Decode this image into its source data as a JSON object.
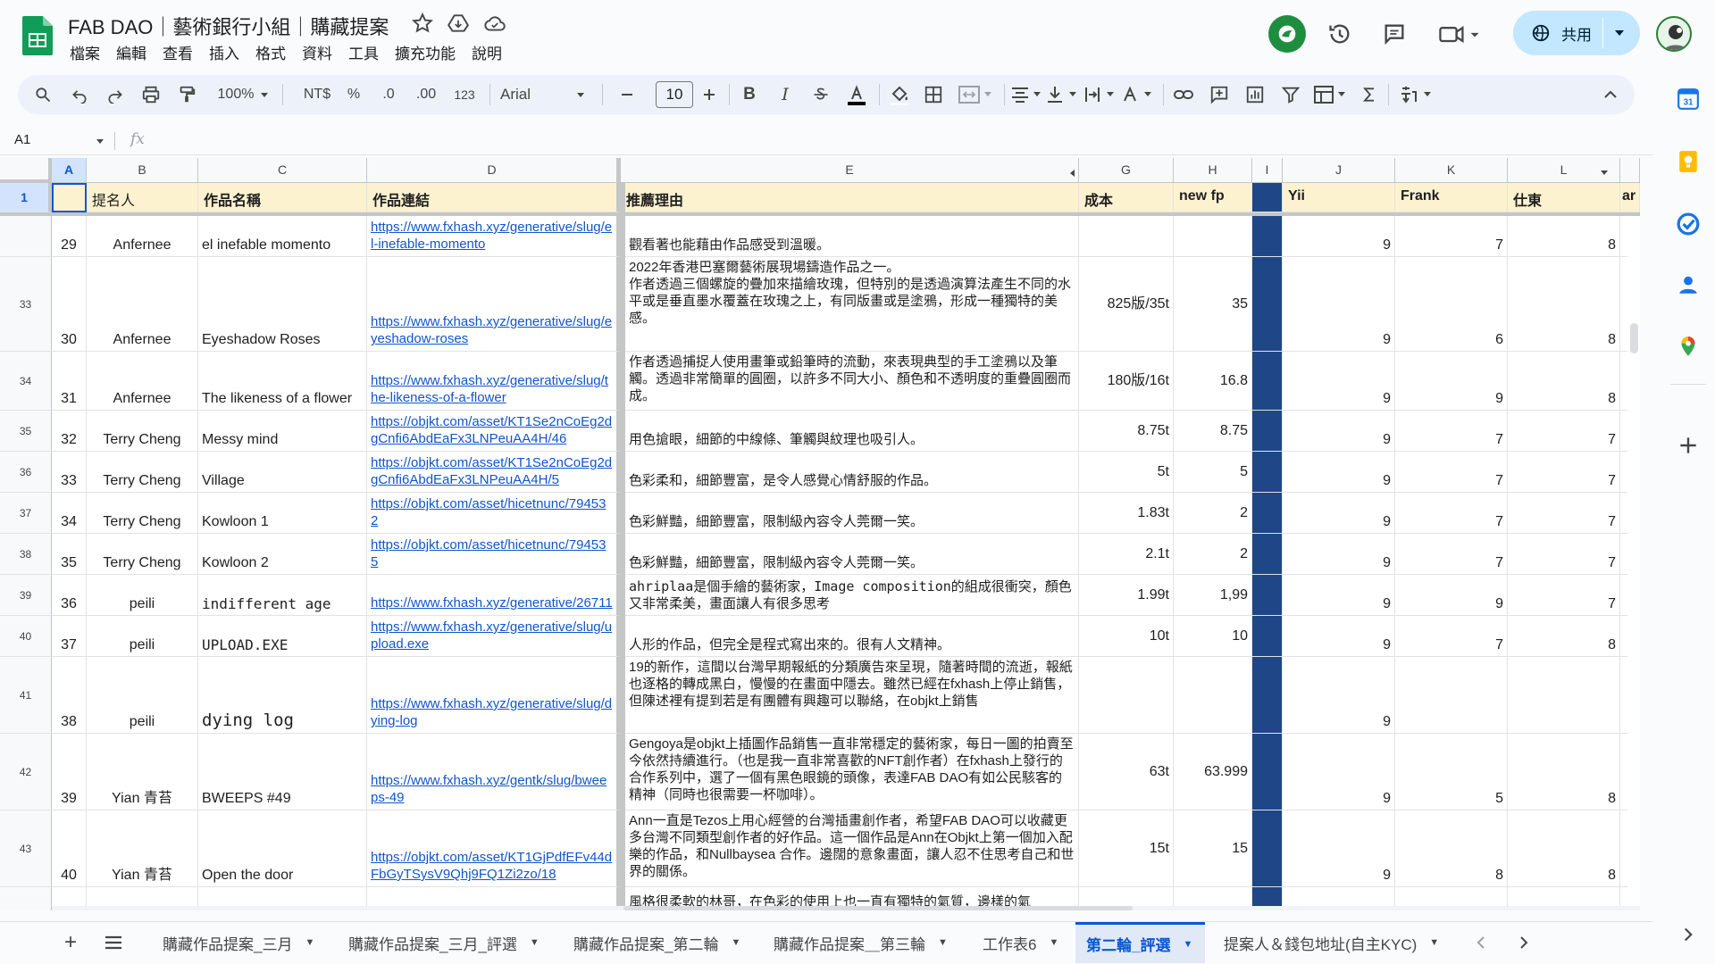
{
  "doc": {
    "title": "FAB DAO｜藝術銀行小組｜購藏提案"
  },
  "menu": [
    "檔案",
    "編輯",
    "查看",
    "插入",
    "格式",
    "資料",
    "工具",
    "擴充功能",
    "說明"
  ],
  "share": {
    "label": "共用"
  },
  "toolbar": {
    "zoom": "100%",
    "currency": "NT$",
    "percent": "%",
    "dec_minus": ".0",
    "dec_plus": ".00",
    "format123": "123",
    "font": "Arial",
    "font_size": "10"
  },
  "formula": {
    "cell_ref": "A1",
    "fx": "fx"
  },
  "columns": [
    "A",
    "B",
    "C",
    "D",
    "E",
    "G",
    "H",
    "I",
    "J",
    "K",
    "L"
  ],
  "header_row": {
    "row_num": "1",
    "B": "提名人",
    "C": "作品名稱",
    "D": "作品連結",
    "E": "推薦理由",
    "G": "成本",
    "H": "new fp",
    "J": "Yii",
    "K": "Frank",
    "L": "仕東",
    "M": "ar"
  },
  "rows": [
    {
      "rownum": "",
      "a": "29",
      "b": "Anfernee",
      "c": "el inefable momento",
      "d": "https://www.fxhash.xyz/generative/slug/el-inefable-momento",
      "e": "觀看著也能藉由作品感受到溫暖。",
      "g": "",
      "h": "",
      "j": "9",
      "k": "7",
      "l": "8"
    },
    {
      "rownum": "33",
      "a": "30",
      "b": "Anfernee",
      "c": "Eyeshadow Roses",
      "d": "https://www.fxhash.xyz/generative/slug/eyeshadow-roses",
      "e": "2022年香港巴塞爾藝術展現場鑄造作品之一。\n作者透過三個螺旋的疊加來描繪玫瑰，但特別的是透過演算法產生不同的水平或是垂直墨水覆蓋在玫瑰之上，有同版畫或是塗鴉，形成一種獨特的美感。",
      "g": "825版/35t",
      "h": "35",
      "j": "9",
      "k": "6",
      "l": "8"
    },
    {
      "rownum": "34",
      "a": "31",
      "b": "Anfernee",
      "c": "The likeness of a flower",
      "d": "https://www.fxhash.xyz/generative/slug/the-likeness-of-a-flower",
      "e": "作者透過捕捉人使用畫筆或鉛筆時的流動，來表現典型的手工塗鴉以及筆觸。透過非常簡單的圓圈，以許多不同大小、顏色和不透明度的重疊圓圈而成。",
      "g": "180版/16t",
      "h": "16.8",
      "j": "9",
      "k": "9",
      "l": "8"
    },
    {
      "rownum": "35",
      "a": "32",
      "b": "Terry Cheng",
      "c": "Messy mind",
      "d": "https://objkt.com/asset/KT1Se2nCoEg2dgCnfi6AbdEaFx3LNPeuAA4H/46",
      "e": "用色搶眼，細節的中線條、筆觸與紋理也吸引人。",
      "g": "8.75t",
      "h": "8.75",
      "j": "9",
      "k": "7",
      "l": "7"
    },
    {
      "rownum": "36",
      "a": "33",
      "b": "Terry Cheng",
      "c": "Village",
      "d": "https://objkt.com/asset/KT1Se2nCoEg2dgCnfi6AbdEaFx3LNPeuAA4H/5",
      "e": "色彩柔和，細節豐富，是令人感覺心情舒服的作品。",
      "g": "5t",
      "h": "5",
      "j": "9",
      "k": "7",
      "l": "7"
    },
    {
      "rownum": "37",
      "a": "34",
      "b": "Terry Cheng",
      "c": "Kowloon 1",
      "d": "https://objkt.com/asset/hicetnunc/794532",
      "e": "色彩鮮豔，細節豐富，限制級內容令人莞爾一笑。",
      "g": "1.83t",
      "h": "2",
      "j": "9",
      "k": "7",
      "l": "7"
    },
    {
      "rownum": "38",
      "a": "35",
      "b": "Terry Cheng",
      "c": "Kowloon 2",
      "d": "https://objkt.com/asset/hicetnunc/794535",
      "e": "色彩鮮豔，細節豐富，限制級內容令人莞爾一笑。",
      "g": "2.1t",
      "h": "2",
      "j": "9",
      "k": "7",
      "l": "7"
    },
    {
      "rownum": "39",
      "a": "36",
      "b": "peili",
      "c": "indifferent age",
      "d": "https://www.fxhash.xyz/generative/26711",
      "e": "ahriplaa是個手繪的藝術家，Image composition的組成很衝突，顏色又非常柔美，畫面讓人有很多思考",
      "g": "1.99t",
      "h": "1,99",
      "j": "9",
      "k": "9",
      "l": "7"
    },
    {
      "rownum": "40",
      "a": "37",
      "b": "peili",
      "c": "UPLOAD.EXE",
      "d": "https://www.fxhash.xyz/generative/slug/upload.exe",
      "e": "人形的作品，但完全是程式寫出來的。很有人文精神。",
      "g": "10t",
      "h": "10",
      "j": "9",
      "k": "7",
      "l": "8"
    },
    {
      "rownum": "41",
      "a": "38",
      "b": "peili",
      "c": "dying log",
      "d": "https://www.fxhash.xyz/generative/slug/dying-log",
      "e": "19的新作，這間以台灣早期報紙的分類廣告來呈現，隨著時間的流逝，報紙也逐格的轉成黑白，慢慢的在畫面中隱去。雖然已經在fxhash上停止銷售，但陳述裡有提到若是有團體有興趣可以聯絡，在objkt上銷售",
      "g": "",
      "h": "",
      "j": "9",
      "k": "",
      "l": ""
    },
    {
      "rownum": "42",
      "a": "39",
      "b": "Yian 青苔",
      "c": "BWEEPS #49",
      "d": "https://www.fxhash.xyz/gentk/slug/bweeps-49",
      "e": "Gengoya是objkt上插圖作品銷售一直非常穩定的藝術家，每日一圖的拍賣至今依然持續進行。（也是我一直非常喜歡的NFT創作者）在fxhash上發行的合作系列中，選了一個有黑色眼鏡的頭像，表達FAB DAO有如公民駭客的精神（同時也很需要一杯咖啡）。",
      "g": "63t",
      "h": "63.999",
      "j": "9",
      "k": "5",
      "l": "8"
    },
    {
      "rownum": "43",
      "a": "40",
      "b": "Yian 青苔",
      "c": "Open the door",
      "d": "https://objkt.com/asset/KT1GjPdfEFv44dFbGyTSysV9Qhj9FQ1Zi2zo/18",
      "e": "Ann一直是Tezos上用心經營的台灣插畫創作者，希望FAB DAO可以收藏更多台灣不同類型創作者的好作品。這一個作品是Ann在Objkt上第一個加入配樂的作品，和Nullbaysea 合作。邊闊的意象畫面，讓人忍不住思考自己和世界的關係。",
      "g": "15t",
      "h": "15",
      "j": "9",
      "k": "8",
      "l": "8"
    },
    {
      "rownum": "",
      "a": "",
      "b": "",
      "c": "",
      "d": "",
      "e": "風格很柔軟的林哥，在色彩的使用上也一直有獨特的氣質，邊樣的氣",
      "g": "",
      "h": "",
      "j": "",
      "k": "",
      "l": ""
    }
  ],
  "sheet_tabs": [
    "購藏作品提案_三月",
    "購藏作品提案_三月_評選",
    "購藏作品提案_第二輪",
    "購藏作品提案＿第三輪",
    "工作表6",
    "第二輪_評選",
    "提案人＆錢包地址(自主KYC)"
  ],
  "colors": {
    "header_fill": "#fdf2d0",
    "column_i_fill": "#1f4788",
    "link": "#1155cc",
    "active_tab": "#0b57d0"
  }
}
